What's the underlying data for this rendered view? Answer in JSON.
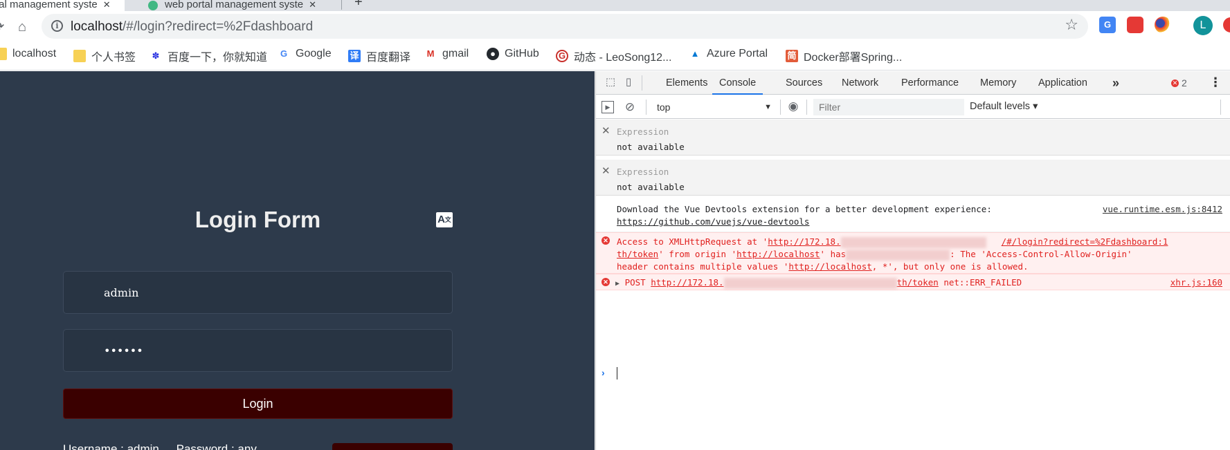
{
  "browser": {
    "tabs": [
      {
        "title": "tal management syste",
        "active": true
      },
      {
        "title": "web portal management syste",
        "active": false
      }
    ],
    "url_host": "localhost",
    "url_rest": "/#/login?redirect=%2Fdashboard",
    "avatar_letter": "L",
    "bookmarks": [
      "localhost",
      "个人书签",
      "百度一下，你就知道",
      "Google",
      "百度翻译",
      "gmail",
      "GitHub",
      "动态 - LeoSong12...",
      "Azure Portal",
      "Docker部署Spring..."
    ]
  },
  "login": {
    "title": "Login Form",
    "username": "admin",
    "password": "••••••",
    "button_label": "Login",
    "tip_username": "Username : admin",
    "tip_password": "Password : any"
  },
  "devtools": {
    "tabs": [
      "Elements",
      "Console",
      "Sources",
      "Network",
      "Performance",
      "Memory",
      "Application"
    ],
    "active_tab": "Console",
    "more_tabs": "»",
    "error_count": "2",
    "context": "top",
    "filter_placeholder": "Filter",
    "levels": "Default levels ▾",
    "expressions": [
      {
        "label": "Expression",
        "value": "not available"
      },
      {
        "label": "Expression",
        "value": "not available"
      }
    ],
    "messages": {
      "info_line1": "Download the Vue Devtools extension for a better development experience:",
      "info_link": "https://github.com/vuejs/vue-devtools",
      "info_src": "vue.runtime.esm.js:8412",
      "cors_p1": "Access to XMLHttpRequest at '",
      "cors_url_start": "http://172.18.",
      "cors_url_end": "/#/login?redirect=%2Fdashboard:1",
      "cors_p2a": "th/token",
      "cors_p2b": "' from origin '",
      "cors_origin": "http://localhost",
      "cors_p2c": "' has",
      "cors_p2d": ": The 'Access-Control-Allow-Origin'",
      "cors_p3a": "header contains multiple values '",
      "cors_p3link": "http://localhost",
      "cors_p3b": ", *', but only one is allowed.",
      "post_method": "POST",
      "post_url_start": "http://172.18.",
      "post_url_end": "th/token",
      "post_err": "net::ERR_FAILED",
      "post_src": "xhr.js:160"
    }
  }
}
